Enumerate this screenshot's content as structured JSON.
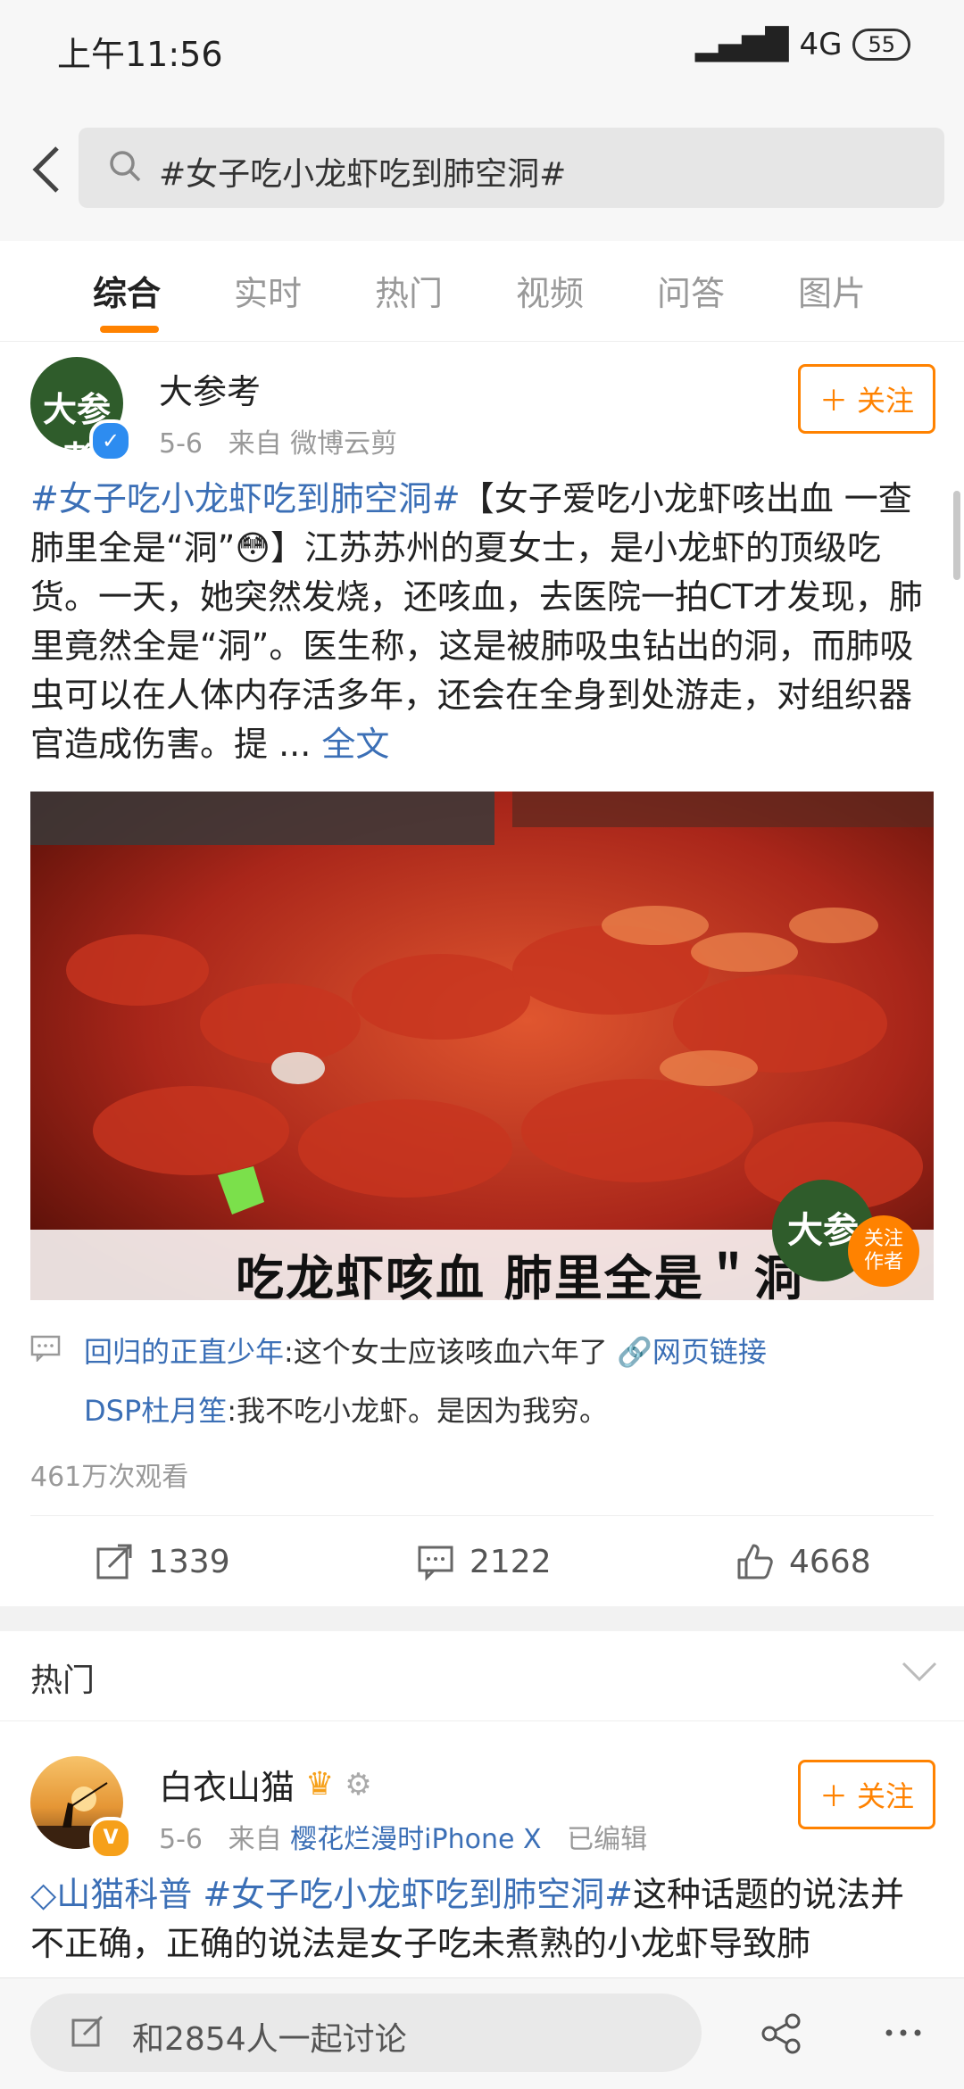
{
  "status_bar": {
    "time": "上午11:56",
    "network": "4G",
    "battery": "55"
  },
  "search": {
    "query": "#女子吃小龙虾吃到肺空洞#"
  },
  "tabs": [
    {
      "label": "综合",
      "active": true
    },
    {
      "label": "实时",
      "active": false
    },
    {
      "label": "热门",
      "active": false
    },
    {
      "label": "视频",
      "active": false
    },
    {
      "label": "问答",
      "active": false
    },
    {
      "label": "图片",
      "active": false
    }
  ],
  "post1": {
    "avatar_text": "大参考",
    "author": "大参考",
    "date": "5-6",
    "source_prefix": "来自",
    "source": "微博云剪",
    "follow_label": "关注",
    "hashtag": "#女子吃小龙虾吃到肺空洞#",
    "body": "【女子爱吃小龙虾咳出血 一查肺里全是“洞”😳】江苏苏州的夏女士，是小龙虾的顶级吃货。一天，她突然发烧，还咳血，去医院一拍CT才发现，肺里竟然全是“洞”。医生称，这是被肺吸虫钻出的洞，而肺吸虫可以在人体内存活多年，还会在全身到处游走，对组织器官造成伤害。提 ...",
    "full_text_label": "全文",
    "video_caption": "吃龙虾咳血  肺里全是＂洞",
    "video_avatar_text": "大参考",
    "video_follow_badge_line1": "关注",
    "video_follow_badge_line2": "作者",
    "comments": [
      {
        "user": "回归的正直少年",
        "text": ":这个女士应该咳血六年了",
        "link": "网页链接"
      },
      {
        "user": "DSP杜月笙",
        "text": ":我不吃小龙虾。是因为我穷。",
        "link": ""
      }
    ],
    "views": "461万次观看",
    "reposts": "1339",
    "comments_count": "2122",
    "likes": "4668"
  },
  "hot_section": {
    "title": "热门"
  },
  "post2": {
    "author": "白衣山猫",
    "date": "5-6",
    "source_prefix": "来自",
    "source": "樱花烂漫时iPhone X",
    "edited": "已编辑",
    "follow_label": "关注",
    "topic": "山猫科普",
    "hashtag": "#女子吃小龙虾吃到肺空洞#",
    "body": "这种话题的说法并不正确，正确的说法是女子吃未煮熟的小龙虾导致肺"
  },
  "bottom_bar": {
    "discuss_placeholder": "和2854人一起讨论"
  },
  "colors": {
    "accent": "#ff8200",
    "link": "#3b6fb6"
  }
}
